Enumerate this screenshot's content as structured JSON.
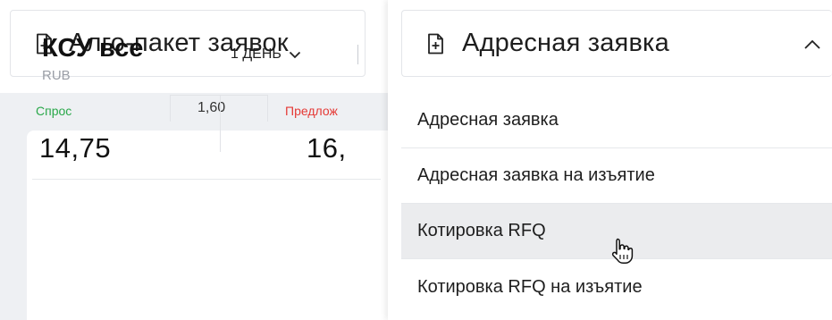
{
  "buttons": {
    "algo_package": "Алго-пакет заявок",
    "address_order": "Адресная заявка"
  },
  "card": {
    "title": "КСУ все",
    "currency": "RUB",
    "period": "1 ДЕНЬ",
    "bid_label": "Спрос",
    "spread": "1,60",
    "ask_label": "Предлож",
    "bid_value": "14,75",
    "ask_value": "16,"
  },
  "menu": {
    "items": [
      {
        "label": "Адресная заявка"
      },
      {
        "label": "Адресная заявка на изъятие"
      },
      {
        "label": "Котировка RFQ"
      },
      {
        "label": "Котировка RFQ на изъятие"
      }
    ],
    "hovered_index": 2
  },
  "colors": {
    "bid": "#2aa84a",
    "ask": "#e53935",
    "workspace_bg": "#eef0f3",
    "hover_bg": "#ebecee"
  },
  "icons": [
    "file-plus-icon",
    "chevron-down-icon",
    "chevron-up-icon",
    "hand-pointer-cursor"
  ]
}
